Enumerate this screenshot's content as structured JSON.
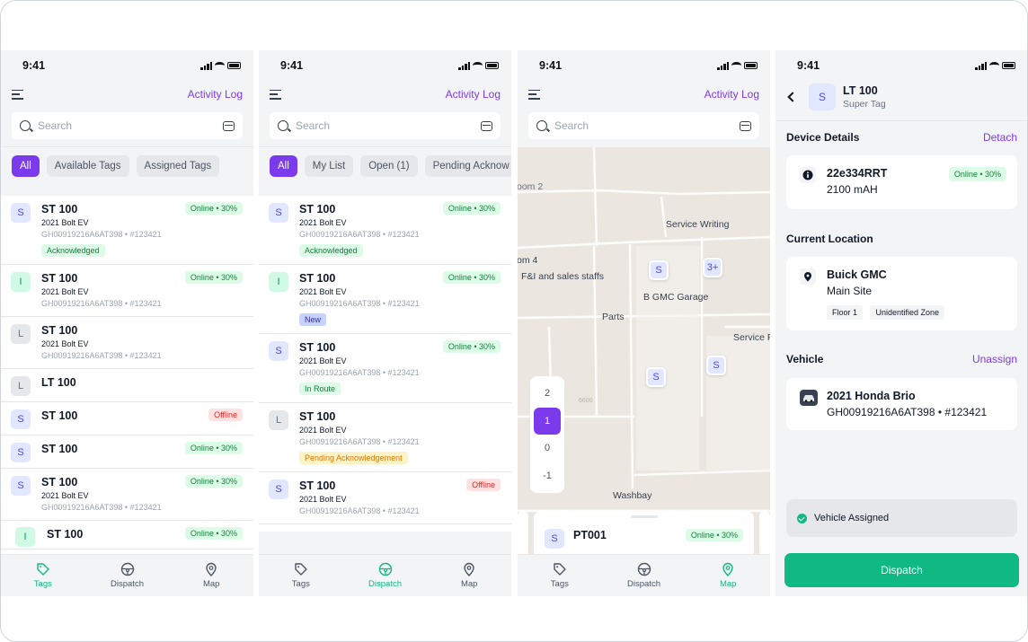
{
  "status_time": "9:41",
  "activity_log": "Activity Log",
  "search_placeholder": "Search",
  "tabs": {
    "tags": "Tags",
    "dispatch": "Dispatch",
    "map": "Map"
  },
  "screen1": {
    "filters": [
      "All",
      "Available Tags",
      "Assigned Tags"
    ],
    "rows": [
      {
        "avatar": "S",
        "title": "ST 100",
        "sub": "2021 Bolt EV",
        "id": "GH00919216A6AT398 • #123421",
        "badge": "Online • 30%",
        "tag": "Acknowledged"
      },
      {
        "avatar": "I",
        "title": "ST 100",
        "sub": "2021 Bolt EV",
        "id": "GH00919216A6AT398 • #123421",
        "badge": "Online • 30%"
      },
      {
        "avatar": "L",
        "title": "ST 100",
        "sub": "2021 Bolt EV",
        "id": "GH00919216A6AT398 • #123421"
      },
      {
        "avatar": "L",
        "title": "LT 100"
      },
      {
        "avatar": "S",
        "title": "ST 100",
        "badge": "Offline"
      },
      {
        "avatar": "S",
        "title": "ST 100",
        "badge": "Online • 30%"
      },
      {
        "avatar": "S",
        "title": "ST 100",
        "sub": "2021 Bolt EV",
        "id": "GH00919216A6AT398 • #123421",
        "badge": "Online • 30%"
      },
      {
        "avatar": "I",
        "title": "ST 100",
        "badge": "Online • 30%"
      }
    ]
  },
  "screen2": {
    "filters": [
      "All",
      "My List",
      "Open (1)",
      "Pending Acknow"
    ],
    "rows": [
      {
        "avatar": "S",
        "title": "ST 100",
        "sub": "2021 Bolt EV",
        "id": "GH00919216A6AT398 • #123421",
        "badge": "Online • 30%",
        "tag": "Acknowledged"
      },
      {
        "avatar": "I",
        "title": "ST 100",
        "sub": "2021 Bolt EV",
        "id": "GH00919216A6AT398 • #123421",
        "badge": "Online • 30%",
        "tag": "New"
      },
      {
        "avatar": "S",
        "title": "ST 100",
        "sub": "2021 Bolt EV",
        "id": "GH00919216A6AT398 • #123421",
        "badge": "Online • 30%",
        "tag": "In Route"
      },
      {
        "avatar": "L",
        "title": "ST 100",
        "sub": "2021 Bolt EV",
        "id": "GH00919216A6AT398 • #123421",
        "tag": "Pending Acknowledgement"
      },
      {
        "avatar": "S",
        "title": "ST 100",
        "sub": "2021 Bolt EV",
        "id": "GH00919216A6AT398 • #123421",
        "badge": "Offline"
      }
    ]
  },
  "screen3": {
    "labels": {
      "room2": "oom 2",
      "room4": "om 4",
      "service_writing": "Service Writing",
      "fi_staff": "F&I and sales staffs",
      "garage": "B GMC Garage",
      "parts": "Parts",
      "service_f": "Service F",
      "washbay": "Washbay",
      "faint": "6600"
    },
    "pins": [
      "S",
      "3+",
      "S",
      "S"
    ],
    "floors": [
      "2",
      "1",
      "0",
      "-1"
    ],
    "sheet": {
      "avatar": "S",
      "title": "PT001",
      "badge": "Online • 30%"
    }
  },
  "screen4": {
    "avatar": "S",
    "title": "LT 100",
    "subtitle": "Super Tag",
    "device_details": "Device Details",
    "detach": "Detach",
    "device": {
      "id": "22e334RRT",
      "battery": "2100 mAH",
      "badge": "Online • 30%"
    },
    "current_location": "Current Location",
    "location": {
      "name": "Buick GMC",
      "site": "Main Site",
      "floor": "Floor 1",
      "zone": "Unidentified Zone"
    },
    "vehicle_heading": "Vehicle",
    "unassign": "Unassign",
    "vehicle": {
      "name": "2021 Honda Brio",
      "id": "GH00919216A6AT398 • #123421"
    },
    "assigned_status": "Vehicle Assigned",
    "dispatch_button": "Dispatch"
  },
  "colors": {
    "accent": "#7c3aed",
    "success": "#10b981",
    "danger": "#dc2626",
    "warning": "#d97706"
  },
  "icons": [
    "menu-icon",
    "search-icon",
    "scan-icon",
    "tag-icon",
    "steering-wheel-icon",
    "map-pin-icon",
    "back-icon",
    "info-icon",
    "location-icon",
    "car-icon",
    "check-icon"
  ]
}
